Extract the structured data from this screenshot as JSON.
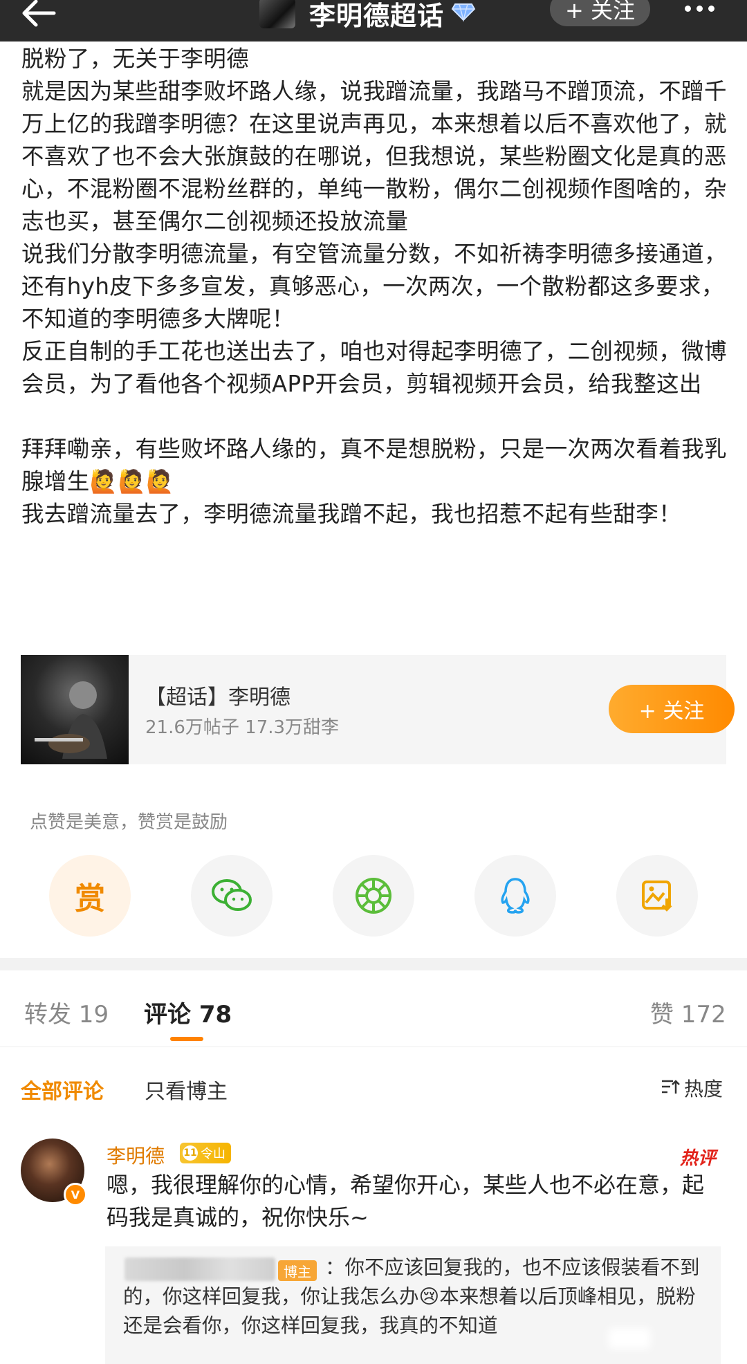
{
  "topbar": {
    "title": "李明德超话",
    "follow_label": "+ 关注"
  },
  "post": {
    "paragraphs": [
      "脱粉了，无关于李明德",
      "就是因为某些甜李败坏路人缘，说我蹭流量，我踏马不蹭顶流，不蹭千万上亿的我蹭李明德？在这里说声再见，本来想着以后不喜欢他了，就不喜欢了也不会大张旗鼓的在哪说，但我想说，某些粉圈文化是真的恶心，不混粉圈不混粉丝群的，单纯一散粉，偶尔二创视频作图啥的，杂志也买，甚至偶尔二创视频还投放流量",
      "说我们分散李明德流量，有空管流量分数，不如祈祷李明德多接通道，还有hyh皮下多多宣发，真够恶心，一次两次，一个散粉都这多要求，不知道的李明德多大牌呢！",
      "反正自制的手工花也送出去了，咱也对得起李明德了，二创视频，微博会员，为了看他各个视频APP开会员，剪辑视频开会员，给我整这出",
      "",
      "拜拜嘞亲，有些败坏路人缘的，真不是想脱粉，只是一次两次看着我乳腺增生🙋🙋🙋",
      "我去蹭流量去了，李明德流量我蹭不起，我也招惹不起有些甜李！"
    ]
  },
  "topic_card": {
    "title": "【超话】李明德",
    "stats": "21.6万帖子 17.3万甜李",
    "follow_label": "+ 关注"
  },
  "reward": {
    "tip": "点赞是美意，赞赏是鼓励",
    "reward_label": "赏"
  },
  "tabs": [
    {
      "label": "转发 19"
    },
    {
      "label": "评论 78"
    },
    {
      "label": "赞 172"
    }
  ],
  "filters": {
    "all": "全部评论",
    "owner_only": "只看博主",
    "sort": "热度"
  },
  "comment": {
    "name": "李明德",
    "fan_level": "11",
    "fan_label": "令山",
    "hot_tag": "热评",
    "text": "嗯，我很理解你的心情，希望你开心，某些人也不必在意，起码我是真诚的，祝你快乐~",
    "reply_owner_tag": "博主",
    "reply_text": "：你不应该回复我的，也不应该假装看不到的，你这样回复我，你让我怎么办😢本来想着以后顶峰相见，脱粉还是会看你，你这样回复我，我真的不知道"
  },
  "colors": {
    "accent": "#ff8200",
    "topbar": "#2b2b2b",
    "hot": "#e2231a"
  }
}
